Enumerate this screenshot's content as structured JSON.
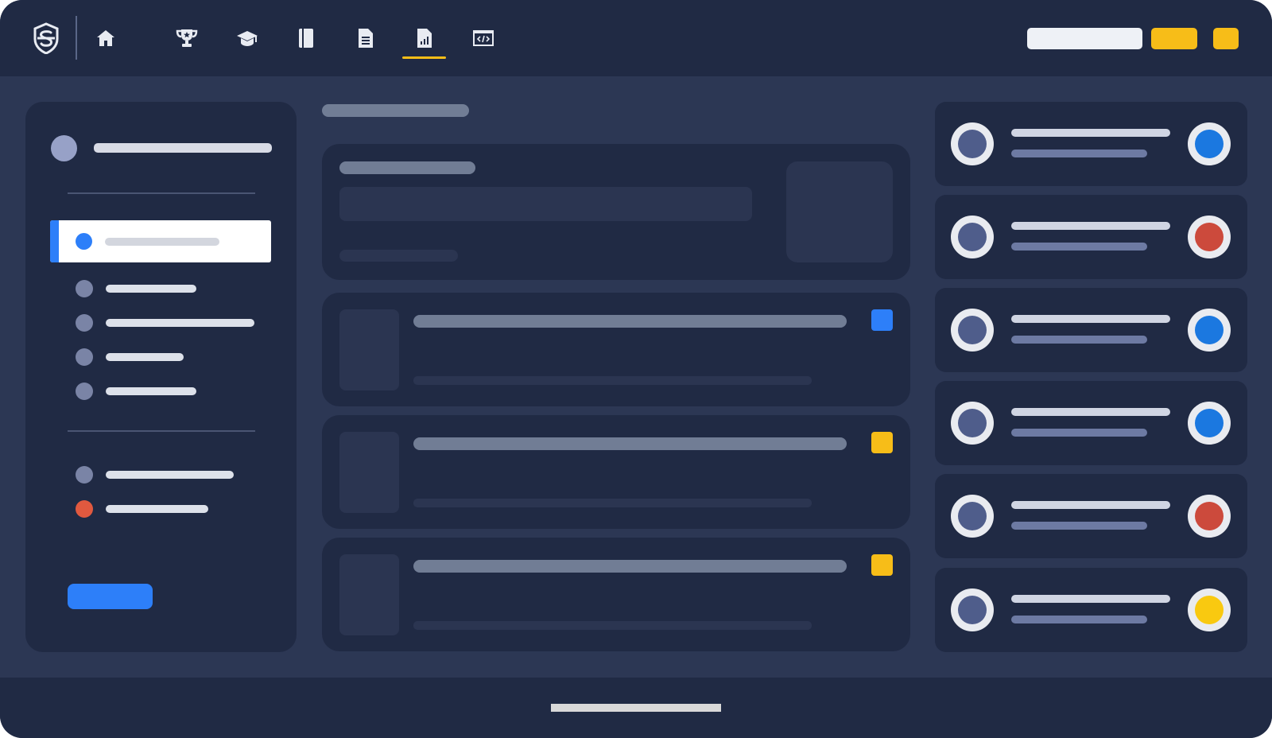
{
  "colors": {
    "background": "#2c3754",
    "panel": "#202a44",
    "accent_blue": "#2d7ff9",
    "accent_yellow": "#f7bd18",
    "status_red": "#cc4a3c",
    "status_blue": "#1b78e0",
    "status_yellow": "#f9c910",
    "text_placeholder": "#717d95"
  },
  "topbar": {
    "logo_icon": "shield-s-logo",
    "nav": [
      {
        "icon": "home-icon",
        "active": false
      },
      {
        "icon": "trophy-icon",
        "active": false
      },
      {
        "icon": "graduation-cap-icon",
        "active": false
      },
      {
        "icon": "book-icon",
        "active": false
      },
      {
        "icon": "document-icon",
        "active": false
      },
      {
        "icon": "report-chart-icon",
        "active": true
      },
      {
        "icon": "code-window-icon",
        "active": false
      }
    ]
  },
  "sidebar": {
    "primary_items": [
      {
        "dot": "#2d7ff9",
        "active": true
      },
      {
        "dot": "#7a84a6",
        "active": false
      },
      {
        "dot": "#7a84a6",
        "active": false
      },
      {
        "dot": "#7a84a6",
        "active": false
      },
      {
        "dot": "#7a84a6",
        "active": false
      }
    ],
    "secondary_items": [
      {
        "dot": "#7a84a6"
      },
      {
        "dot": "#e1593f"
      }
    ]
  },
  "main": {
    "rows": [
      {
        "tag_color": "#2d7ff9"
      },
      {
        "tag_color": "#f7bd18"
      },
      {
        "tag_color": "#f7bd18"
      }
    ]
  },
  "right_list": [
    {
      "status_color": "#1b78e0"
    },
    {
      "status_color": "#cc4a3c"
    },
    {
      "status_color": "#1b78e0"
    },
    {
      "status_color": "#1b78e0"
    },
    {
      "status_color": "#cc4a3c"
    },
    {
      "status_color": "#f9c910"
    }
  ]
}
